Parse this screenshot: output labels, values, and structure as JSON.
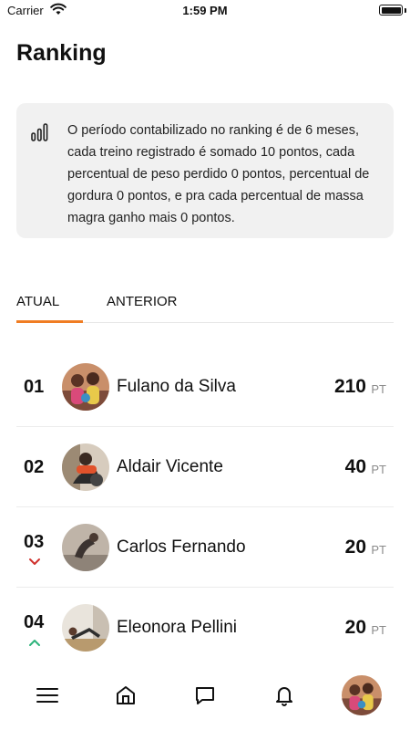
{
  "status_bar": {
    "carrier": "Carrier",
    "time": "1:59 PM"
  },
  "page": {
    "title": "Ranking"
  },
  "info": {
    "text": "O período contabilizado no ranking é de 6 meses, cada treino registrado é somado 10 pontos, cada percentual de peso perdido 0 pontos, percentual de gordura 0 pontos, e pra cada percentual de massa magra ganho mais 0 pontos.",
    "icon": "bar-chart-icon"
  },
  "tabs": [
    {
      "label": "ATUAL",
      "active": true
    },
    {
      "label": "ANTERIOR",
      "active": false
    }
  ],
  "colors": {
    "accent": "#f07d23",
    "trend_down": "#d0312d",
    "trend_up": "#2db37a"
  },
  "ranking": [
    {
      "position": "01",
      "name": "Fulano da Silva",
      "points": "210",
      "unit": "PT",
      "trend": "none"
    },
    {
      "position": "02",
      "name": "Aldair Vicente",
      "points": "40",
      "unit": "PT",
      "trend": "none"
    },
    {
      "position": "03",
      "name": "Carlos Fernando",
      "points": "20",
      "unit": "PT",
      "trend": "down"
    },
    {
      "position": "04",
      "name": "Eleonora Pellini",
      "points": "20",
      "unit": "PT",
      "trend": "up"
    }
  ],
  "bottom_nav": [
    "menu-icon",
    "home-icon",
    "chat-icon",
    "bell-icon",
    "profile-avatar"
  ]
}
